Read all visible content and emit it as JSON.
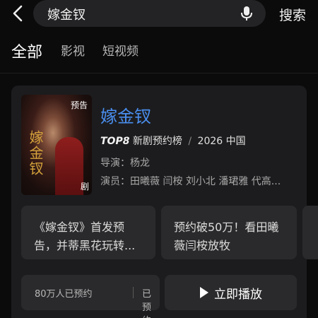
{
  "header": {
    "search_value": "嫁金钗",
    "search_button": "搜索"
  },
  "tabs": [
    {
      "label": "全部",
      "active": true
    },
    {
      "label": "影视",
      "active": false
    },
    {
      "label": "短视频",
      "active": false
    }
  ],
  "result": {
    "title": "嫁金钗",
    "poster": {
      "badge_top": "预告",
      "badge_bottom": "剧",
      "calligraphy": "嫁金钗"
    },
    "rank": "TOP8",
    "rank_desc": "新剧预约榜",
    "separator": "/",
    "year_region": "2026 中国",
    "director": "导演：杨龙",
    "cast": "演员：田曦薇 闫桉 刘小北 潘珺雅 代高..."
  },
  "news": [
    {
      "line1": "《嫁金钗》首发预",
      "line2": "告，并蒂黑花玩转..."
    },
    {
      "line1": "预约破50万！看田曦",
      "line2": "薇闫桉放牧"
    }
  ],
  "actions": {
    "reserve_count": "80万人已预约",
    "reserve_status": "已预约",
    "play_label": "立即播放"
  },
  "colors": {
    "accent": "#4a8ff0",
    "background": "#0b0b0c",
    "card": "#1c1c1e"
  }
}
